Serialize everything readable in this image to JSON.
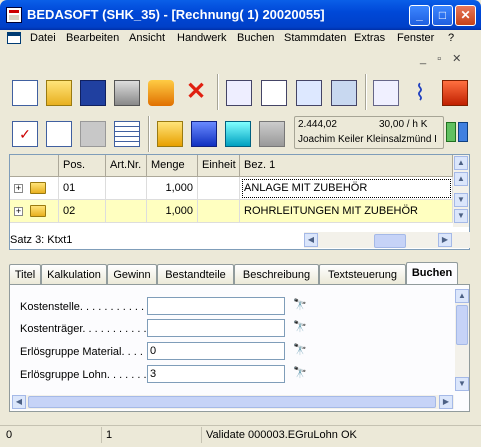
{
  "window": {
    "title": "BEDASOFT (SHK_35) - [Rechnung( 1) 20020055]"
  },
  "menu": {
    "items": [
      "Datei",
      "Bearbeiten",
      "Ansicht",
      "Handwerk",
      "Buchen",
      "Stammdaten",
      "Extras",
      "Fenster",
      "?"
    ]
  },
  "toolbar1": {
    "icons": [
      "new-document-icon",
      "open-folder-icon",
      "save-icon",
      "print-icon",
      "export-icon",
      "delete-icon",
      "contact-card-icon",
      "list-view-icon",
      "document-icon",
      "settings-icon",
      "find-icon",
      "attachment-icon",
      "calendar-icon"
    ]
  },
  "toolbar2": {
    "icons": [
      "checklist-icon",
      "search-document-icon",
      "refresh-icon",
      "table-icon",
      "yellow-folder-icon",
      "blue-folder-icon",
      "cyan-folder-icon",
      "gray-folder-icon"
    ]
  },
  "info": {
    "amount": "2.444,02",
    "rate": "30,00 / h K",
    "customer": "Joachim Keiler Kleinsalzmünd I"
  },
  "grid": {
    "headers": [
      "Pos.",
      "Art.Nr.",
      "Menge",
      "Einheit",
      "Bez. 1"
    ],
    "rows": [
      {
        "pos": "01",
        "artnr": "",
        "menge": "1,000",
        "einheit": "",
        "bez": "ANLAGE MIT ZUBEHÖR"
      },
      {
        "pos": "02",
        "artnr": "",
        "menge": "1,000",
        "einheit": "",
        "bez": "ROHRLEITUNGEN MIT ZUBEHÖR"
      }
    ],
    "status": "Satz 3: Ktxt1"
  },
  "tabs": [
    "Titel",
    "Kalkulation",
    "Gewinn",
    "Bestandteile",
    "Beschreibung",
    "Textsteuerung",
    "Buchen"
  ],
  "form": {
    "fields": [
      {
        "label": "Kostenstelle. . . . . . . . . . . .",
        "value": ""
      },
      {
        "label": "Kostenträger. . . . . . . . . . . .",
        "value": ""
      },
      {
        "label": "Erlösgruppe Material. . . . .",
        "value": "0"
      },
      {
        "label": "Erlösgruppe Lohn. . . . . . . .",
        "value": "3"
      }
    ]
  },
  "statusbar": {
    "cell1": "0",
    "cell2": "1",
    "cell3": "Validate 000003.EGruLohn OK"
  }
}
